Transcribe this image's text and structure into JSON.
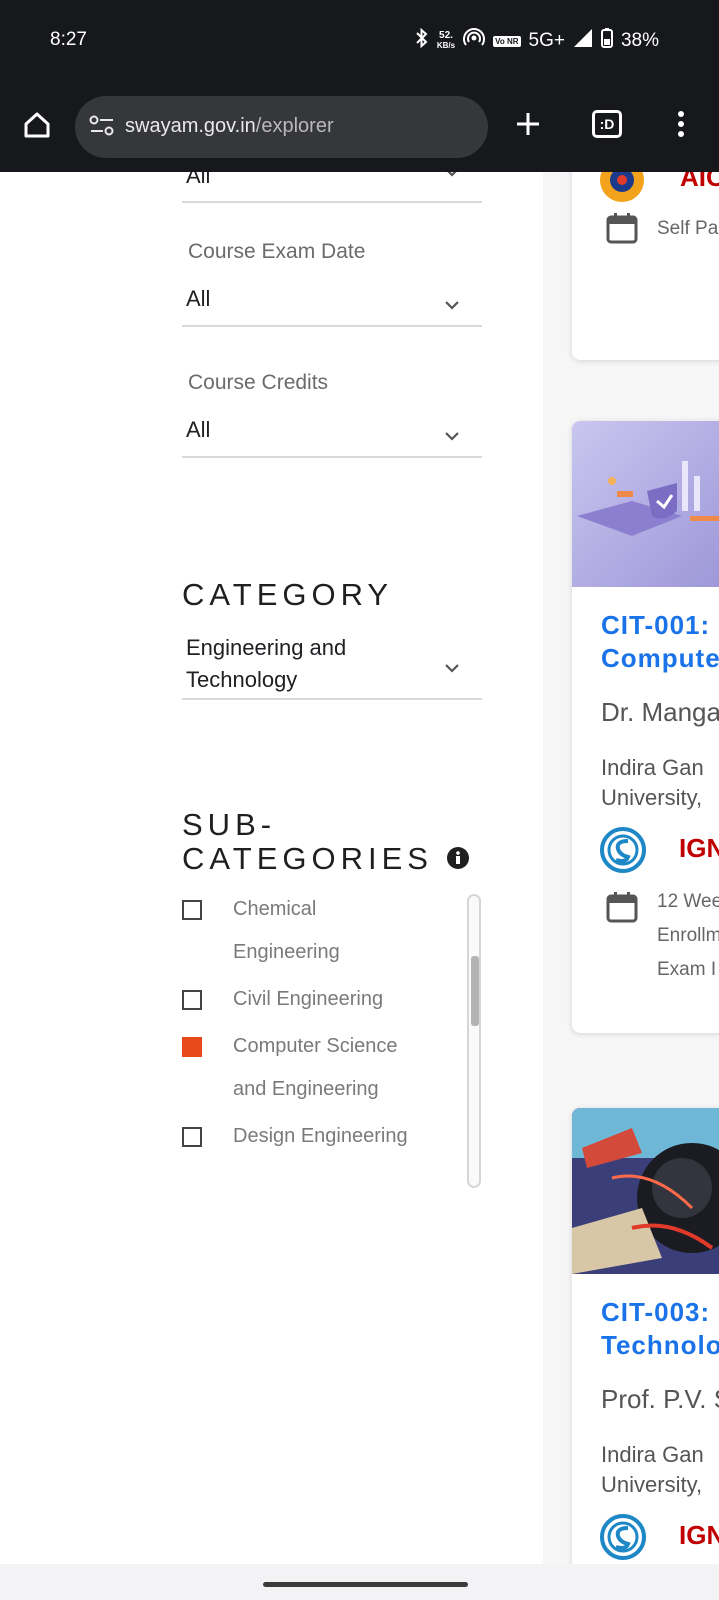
{
  "status_bar": {
    "time": "8:27",
    "net_speed_value": "52.",
    "net_speed_unit": "KB/s",
    "volte": "Vo NR",
    "network": "5G+",
    "battery": "38%"
  },
  "browser": {
    "url_domain": "swayam.gov.in",
    "url_path": "/explorer",
    "tab_switcher_label": ":D"
  },
  "filters": {
    "top_select_value": "All",
    "exam_date": {
      "label": "Course Exam Date",
      "value": "All"
    },
    "credits": {
      "label": "Course Credits",
      "value": "All"
    }
  },
  "category": {
    "title": "CATEGORY",
    "value_line1": "Engineering and",
    "value_line2": "Technology"
  },
  "subcategories": {
    "title_line1": "SUB-",
    "title_line2": "CATEGORIES",
    "items": [
      {
        "label_line1": "Chemical",
        "label_line2": "Engineering",
        "checked": false
      },
      {
        "label_line1": "Civil Engineering",
        "label_line2": "",
        "checked": false
      },
      {
        "label_line1": "Computer Science",
        "label_line2": "and Engineering",
        "checked": true
      },
      {
        "label_line1": "Design Engineering",
        "label_line2": "",
        "checked": false
      }
    ]
  },
  "cards": [
    {
      "org": "AIC",
      "meta1": "Self Pa"
    },
    {
      "title_line1": "CIT-001:",
      "title_line2": "Compute",
      "instructor": "Dr. Manga",
      "uni_line1": "Indira Gan",
      "uni_line2": "University,",
      "org": "IGN",
      "meta1": "12 Wee",
      "meta2": "Enrollm",
      "meta3": "Exam I"
    },
    {
      "title_line1": "CIT-003:",
      "title_line2": "Technolo",
      "instructor": "Prof. P.V. S",
      "uni_line1": "Indira Gan",
      "uni_line2": "University,",
      "org": "IGN"
    }
  ],
  "colors": {
    "accent_checked": "#e94a1c",
    "link_blue": "#1a73e8",
    "org_red": "#c00000",
    "chrome_dark": "#17181b"
  }
}
